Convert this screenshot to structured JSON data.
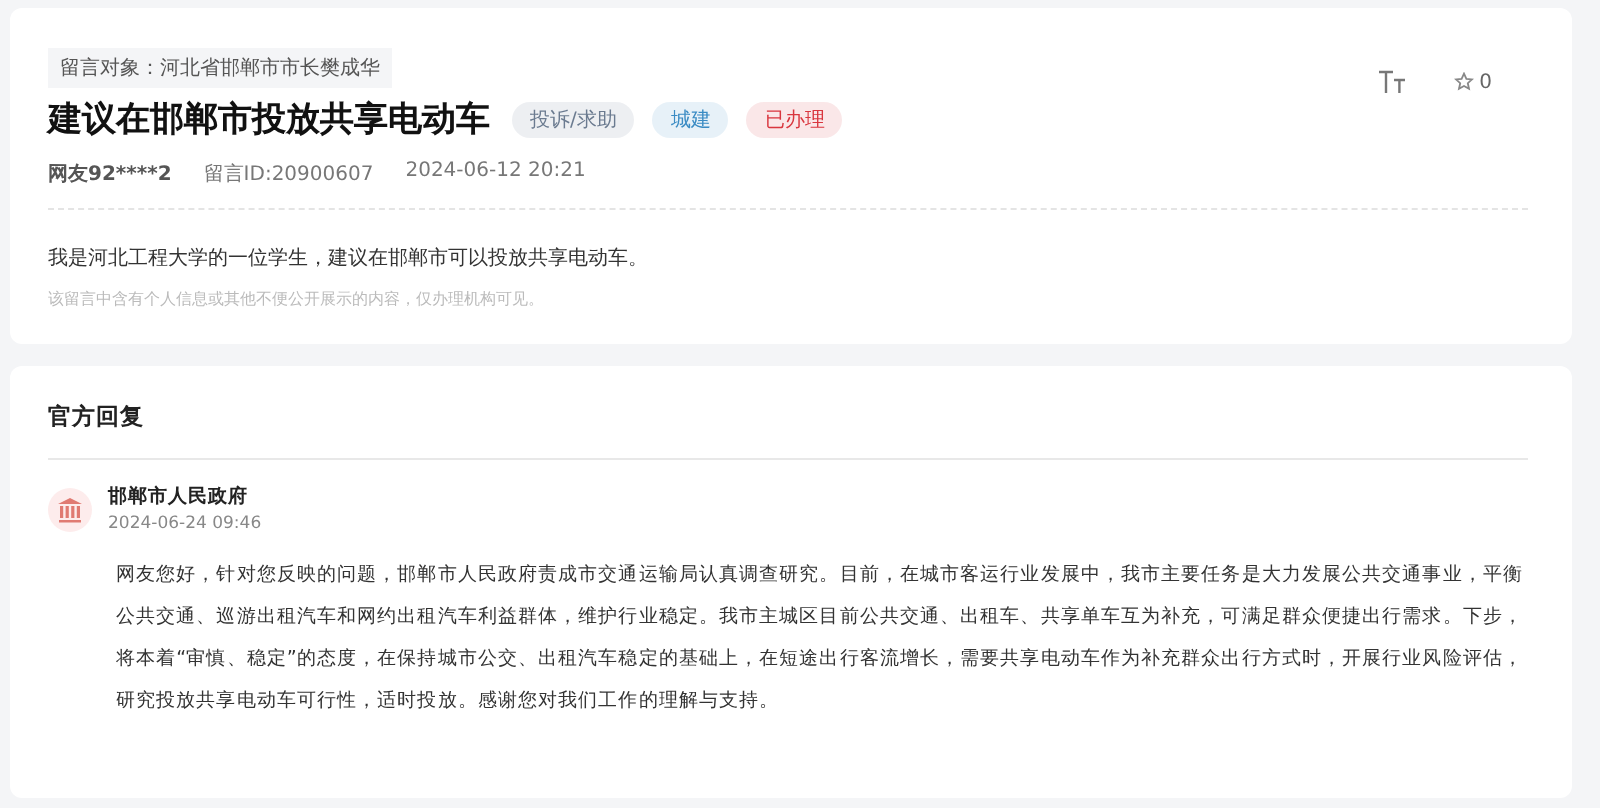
{
  "message": {
    "target": "留言对象：河北省邯郸市市长樊成华",
    "title": "建议在邯郸市投放共享电动车",
    "tags": [
      {
        "label": "投诉/求助",
        "color": "#6b7b90"
      },
      {
        "label": "城建",
        "color": "#3b8cc4"
      },
      {
        "label": "已办理",
        "color": "#d9363e"
      }
    ],
    "author": "网友92****2",
    "id": "留言ID:20900607",
    "time": "2024-06-12 20:21",
    "stars": "0",
    "body": "我是河北工程大学的一位学生，建议在邯郸市可以投放共享电动车。",
    "note": "该留言中含有个人信息或其他不便公开展示的内容，仅办理机构可见。"
  },
  "reply": {
    "heading": "官方回复",
    "org": "邯郸市人民政府",
    "time": "2024-06-24 09:46",
    "body": "网友您好，针对您反映的问题，邯郸市人民政府责成市交通运输局认真调查研究。目前，在城市客运行业发展中，我市主要任务是大力发展公共交通事业，平衡公共交通、巡游出租汽车和网约出租汽车利益群体，维护行业稳定。我市主城区目前公共交通、出租车、共享单车互为补充，可满足群众便捷出行需求。下步，将本着“审慎、稳定”的态度，在保持城市公交、出租汽车稳定的基础上，在短途出行客流增长，需要共享电动车作为补充群众出行方式时，开展行业风险评估，研究投放共享电动车可行性，适时投放。感谢您对我们工作的理解与支持。"
  }
}
